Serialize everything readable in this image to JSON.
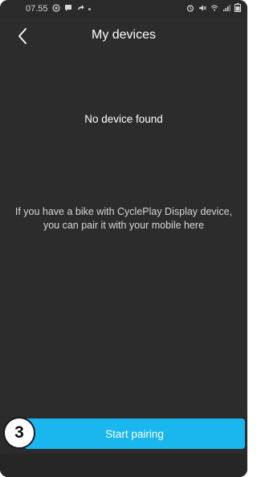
{
  "status_bar": {
    "time": "07.55",
    "icons_left": [
      "circle-notification-icon",
      "chat-icon",
      "share-icon",
      "dot-icon"
    ],
    "icons_right": [
      "alarm-icon",
      "mute-icon",
      "wifi-icon",
      "signal-icon",
      "battery-icon"
    ]
  },
  "app_bar": {
    "title": "My devices",
    "back_icon": "chevron-left-icon"
  },
  "main": {
    "empty_title": "No device found",
    "hint": "If you have a bike with CyclePlay Display device, you can pair it with your mobile here"
  },
  "footer": {
    "start_pairing_label": "Start pairing",
    "step_badge": "3"
  },
  "colors": {
    "background": "#2c2c2c",
    "accent": "#1ab6ee",
    "text": "#ffffff"
  }
}
